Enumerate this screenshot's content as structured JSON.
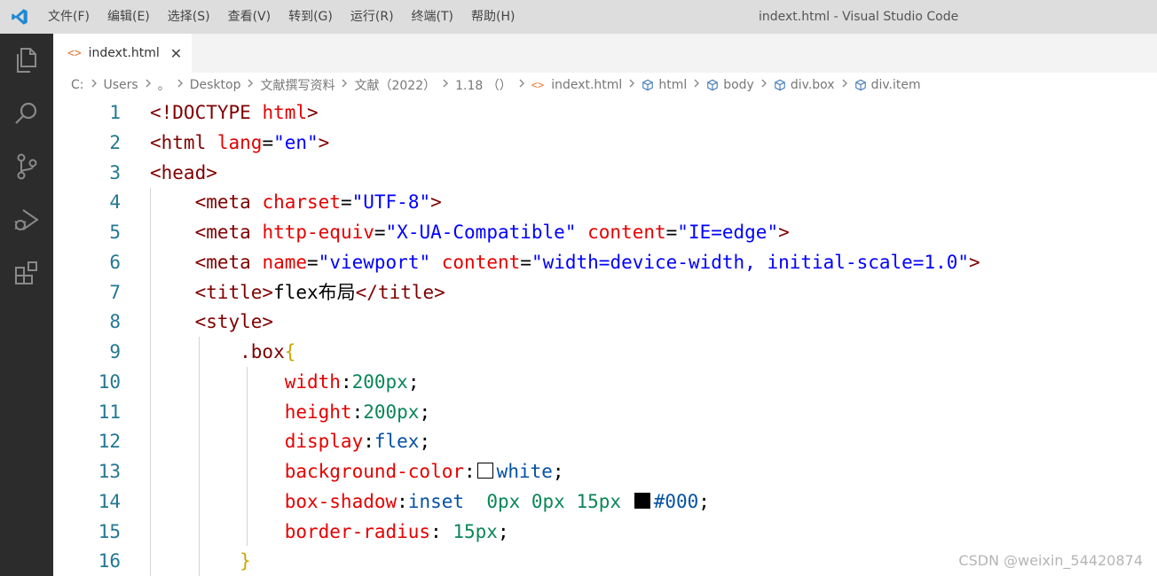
{
  "titlebar": {
    "menus": [
      "文件(F)",
      "编辑(E)",
      "选择(S)",
      "查看(V)",
      "转到(G)",
      "运行(R)",
      "终端(T)",
      "帮助(H)"
    ],
    "window_title": "indext.html - Visual Studio Code"
  },
  "tab": {
    "icon": "<>",
    "label": "indext.html",
    "close": "✕"
  },
  "breadcrumb": {
    "items": [
      "C:",
      "Users",
      "。",
      "Desktop",
      "文献撰写资料",
      "文献（2022）",
      "1.18 （）"
    ],
    "file_label": "indext.html",
    "symbols": [
      "html",
      "body",
      "div.box",
      "div.item"
    ]
  },
  "editor": {
    "line_numbers": [
      "1",
      "2",
      "3",
      "4",
      "5",
      "6",
      "7",
      "8",
      "9",
      "10",
      "11",
      "12",
      "13",
      "14",
      "15",
      "16"
    ],
    "lines": [
      [
        {
          "t": "<!DOCTYPE ",
          "c": "tag"
        },
        {
          "t": "html",
          "c": "attr"
        },
        {
          "t": ">",
          "c": "tag"
        }
      ],
      [
        {
          "t": "<html ",
          "c": "tag"
        },
        {
          "t": "lang",
          "c": "attr"
        },
        {
          "t": "=",
          "c": "txt"
        },
        {
          "t": "\"en\"",
          "c": "str"
        },
        {
          "t": ">",
          "c": "tag"
        }
      ],
      [
        {
          "t": "<head>",
          "c": "tag"
        }
      ],
      [
        {
          "t": "    <meta ",
          "c": "tag"
        },
        {
          "t": "charset",
          "c": "attr"
        },
        {
          "t": "=",
          "c": "txt"
        },
        {
          "t": "\"UTF-8\"",
          "c": "str"
        },
        {
          "t": ">",
          "c": "tag"
        }
      ],
      [
        {
          "t": "    <meta ",
          "c": "tag"
        },
        {
          "t": "http-equiv",
          "c": "attr"
        },
        {
          "t": "=",
          "c": "txt"
        },
        {
          "t": "\"X-UA-Compatible\"",
          "c": "str"
        },
        {
          "t": " ",
          "c": "txt"
        },
        {
          "t": "content",
          "c": "attr"
        },
        {
          "t": "=",
          "c": "txt"
        },
        {
          "t": "\"IE=edge\"",
          "c": "str"
        },
        {
          "t": ">",
          "c": "tag"
        }
      ],
      [
        {
          "t": "    <meta ",
          "c": "tag"
        },
        {
          "t": "name",
          "c": "attr"
        },
        {
          "t": "=",
          "c": "txt"
        },
        {
          "t": "\"viewport\"",
          "c": "str"
        },
        {
          "t": " ",
          "c": "txt"
        },
        {
          "t": "content",
          "c": "attr"
        },
        {
          "t": "=",
          "c": "txt"
        },
        {
          "t": "\"width=device-width, initial-scale=1.0\"",
          "c": "str"
        },
        {
          "t": ">",
          "c": "tag"
        }
      ],
      [
        {
          "t": "    <title>",
          "c": "tag"
        },
        {
          "t": "flex布局",
          "c": "txt"
        },
        {
          "t": "</title>",
          "c": "tag"
        }
      ],
      [
        {
          "t": "    <style>",
          "c": "tag"
        }
      ],
      [
        {
          "t": "        .box",
          "c": "sel"
        },
        {
          "t": "{",
          "c": "brace"
        }
      ],
      [
        {
          "t": "            width",
          "c": "attr"
        },
        {
          "t": ":",
          "c": "txt"
        },
        {
          "t": "200px",
          "c": "num"
        },
        {
          "t": ";",
          "c": "txt"
        }
      ],
      [
        {
          "t": "            height",
          "c": "attr"
        },
        {
          "t": ":",
          "c": "txt"
        },
        {
          "t": "200px",
          "c": "num"
        },
        {
          "t": ";",
          "c": "txt"
        }
      ],
      [
        {
          "t": "            display",
          "c": "attr"
        },
        {
          "t": ":",
          "c": "txt"
        },
        {
          "t": "flex",
          "c": "val"
        },
        {
          "t": ";",
          "c": "txt"
        }
      ],
      [
        {
          "t": "            background-color",
          "c": "attr"
        },
        {
          "t": ":",
          "c": "txt"
        },
        {
          "swatch": "#ffffff"
        },
        {
          "t": "white",
          "c": "val"
        },
        {
          "t": ";",
          "c": "txt"
        }
      ],
      [
        {
          "t": "            box-shadow",
          "c": "attr"
        },
        {
          "t": ":",
          "c": "txt"
        },
        {
          "t": "inset  ",
          "c": "val"
        },
        {
          "t": "0px 0px 15px ",
          "c": "num"
        },
        {
          "swatch": "#000000"
        },
        {
          "t": "#000",
          "c": "val"
        },
        {
          "t": ";",
          "c": "txt"
        }
      ],
      [
        {
          "t": "            border-radius",
          "c": "attr"
        },
        {
          "t": ": ",
          "c": "txt"
        },
        {
          "t": "15px",
          "c": "num"
        },
        {
          "t": ";",
          "c": "txt"
        }
      ],
      [
        {
          "t": "        }",
          "c": "brace"
        }
      ]
    ]
  },
  "watermark": "CSDN @weixin_54420874"
}
